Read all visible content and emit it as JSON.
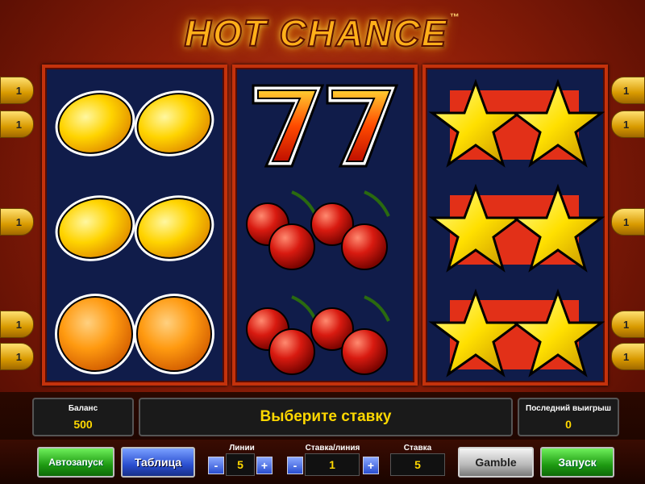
{
  "game": {
    "title": "HOT CHANCE",
    "trademark": "™"
  },
  "reels": [
    {
      "symbols": [
        "lemon",
        "lemon",
        "orange"
      ]
    },
    {
      "symbols": [
        "sevens",
        "cherries",
        "cherries"
      ]
    },
    {
      "symbols": [
        "stars",
        "stars",
        "stars"
      ]
    }
  ],
  "paylines": {
    "left": [
      "1",
      "1",
      "1",
      "1",
      "1"
    ],
    "right": [
      "1",
      "1",
      "1",
      "1",
      "1"
    ]
  },
  "status": {
    "balance_label": "Баланс",
    "balance_value": "500",
    "message": "Выберите ставку",
    "last_win_label": "Последний выигрыш",
    "last_win_value": "0"
  },
  "controls": {
    "autoplay_label": "Автозапуск",
    "paytable_label": "Таблица",
    "lines_label": "Линии",
    "lines_value": "5",
    "bet_per_line_label": "Ставка/линия",
    "bet_per_line_value": "1",
    "bet_label": "Ставка",
    "bet_value": "5",
    "minus": "-",
    "plus": "+",
    "gamble_label": "Gamble",
    "spin_label": "Запуск"
  },
  "colors": {
    "reel_bg": "#101c4a",
    "reel_border": "#c4320c",
    "accent_yellow": "#ffd800"
  }
}
